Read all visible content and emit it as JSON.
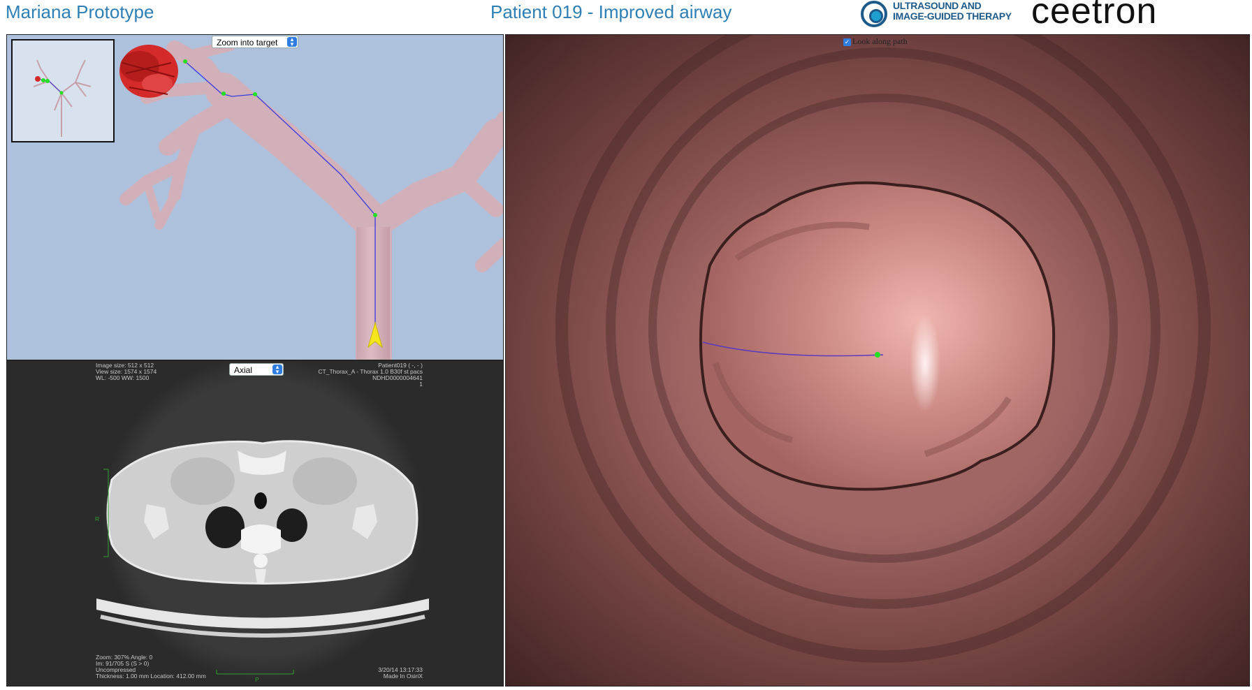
{
  "header": {
    "app_title": "Mariana Prototype",
    "patient_title": "Patient 019 - Improved airway",
    "logo_uigt_line1": "ULTRASOUND AND",
    "logo_uigt_line2": "IMAGE-GUIDED THERAPY",
    "logo_ceetron": "ceetron"
  },
  "tree_view": {
    "zoom_select_value": "Zoom into target",
    "colors": {
      "background": "#adc1dd",
      "airway": "#d7b3bb",
      "target": "#d42a2a",
      "path": "#3a3adf",
      "node": "#22e022",
      "marker": "#f5e51b"
    }
  },
  "ct_view": {
    "view_select_value": "Axial",
    "top_left": [
      "Image size: 512 x 512",
      "View size: 1574 x 1574",
      "WL: -500 WW: 1500"
    ],
    "top_right": [
      "Patient019 ( -, - )",
      "CT_Thorax_A - Thorax 1.0 B30f st pacs",
      "NDHD0000004641",
      "1"
    ],
    "bottom_left": [
      "Zoom: 307% Angle: 0",
      "Im: 91/705 S (S > 0)",
      "Uncompressed",
      "Thickness: 1.00 mm Location: 412.00 mm"
    ],
    "bottom_right": [
      "3/20/14 13:17:33",
      "Made In OsiriX"
    ],
    "orientation_left": "R",
    "orientation_bottom": "P"
  },
  "endoscope_view": {
    "look_along_label": "Look along path",
    "look_along_checked": true,
    "colors": {
      "wall_dark": "#4a2a29",
      "wall_mid": "#8e5a58",
      "lumen": "#c98880",
      "highlight": "#ffe2e2",
      "path": "#5a3abf",
      "node": "#22e022"
    }
  }
}
